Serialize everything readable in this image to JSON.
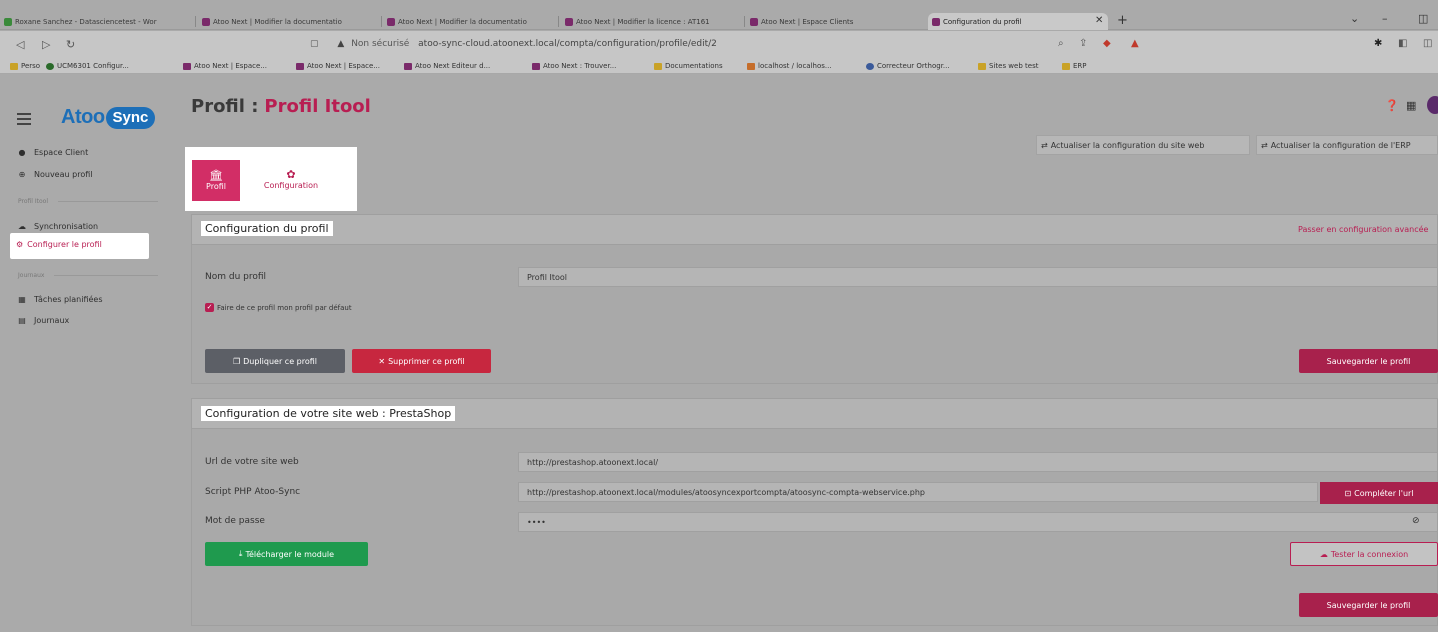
{
  "browser": {
    "tabs": [
      "Roxane Sanchez - Datasciencetest - Wor",
      "Atoo Next | Modifier la documentatio",
      "Atoo Next | Modifier la documentatio",
      "Atoo Next | Modifier la licence : AT161",
      "Atoo Next | Espace Clients",
      "Configuration du profil"
    ],
    "url_warning": "Non sécurisé",
    "url": "atoo-sync-cloud.atoonext.local/compta/configuration/profile/edit/2",
    "bookmarks": [
      "Perso",
      "UCM6301 Configur...",
      "Atoo Next | Espace...",
      "Atoo Next | Espace...",
      "Atoo Next Editeur d...",
      "Atoo Next : Trouver...",
      "Documentations",
      "localhost / localhos...",
      "Correcteur Orthogr...",
      "Sites web test",
      "ERP"
    ]
  },
  "logo": {
    "part1": "Atoo",
    "part2": "Sync"
  },
  "header": {
    "title_prefix": "Profil :",
    "title_name": "Profil Itool"
  },
  "sidebar": {
    "espace_client": "Espace Client",
    "nouveau_profil": "Nouveau profil",
    "section_profile": "Profil Itool",
    "synchronisation": "Synchronisation",
    "configurer": "Configurer le profil",
    "section_journaux": "Journaux",
    "taches": "Tâches planifiées",
    "journaux": "Journaux"
  },
  "actions": {
    "refresh_site": "Actualiser la configuration du site web",
    "refresh_erp": "Actualiser la configuration de l'ERP"
  },
  "tabs": {
    "profil": "Profil",
    "configuration": "Configuration"
  },
  "profile_card": {
    "title": "Configuration du profil",
    "advanced_link": "Passer en configuration avancée",
    "name_label": "Nom du profil",
    "name_value": "Profil Itool",
    "default_checkbox": "Faire de ce profil mon profil par défaut",
    "duplicate_btn": "Dupliquer ce profil",
    "delete_btn": "Supprimer ce profil",
    "save_btn": "Sauvegarder le profil"
  },
  "site_card": {
    "title": "Configuration de votre site web : PrestaShop",
    "url_label": "Url de votre site web",
    "url_value": "http://prestashop.atoonext.local/",
    "script_label": "Script PHP Atoo-Sync",
    "script_value": "http://prestashop.atoonext.local/modules/atoosyncexportcompta/atoosync-compta-webservice.php",
    "complete_btn": "Compléter l'url",
    "password_label": "Mot de passe",
    "password_value": "••••",
    "download_btn": "Télécharger le module",
    "test_btn": "Tester la connexion",
    "save_btn": "Sauvegarder le profil"
  },
  "colors": {
    "accent": "#b81e52",
    "tab_active": "#d22e66",
    "success": "#1f9a4e",
    "danger": "#c7273f",
    "brand_blue": "#1d6fb8"
  }
}
